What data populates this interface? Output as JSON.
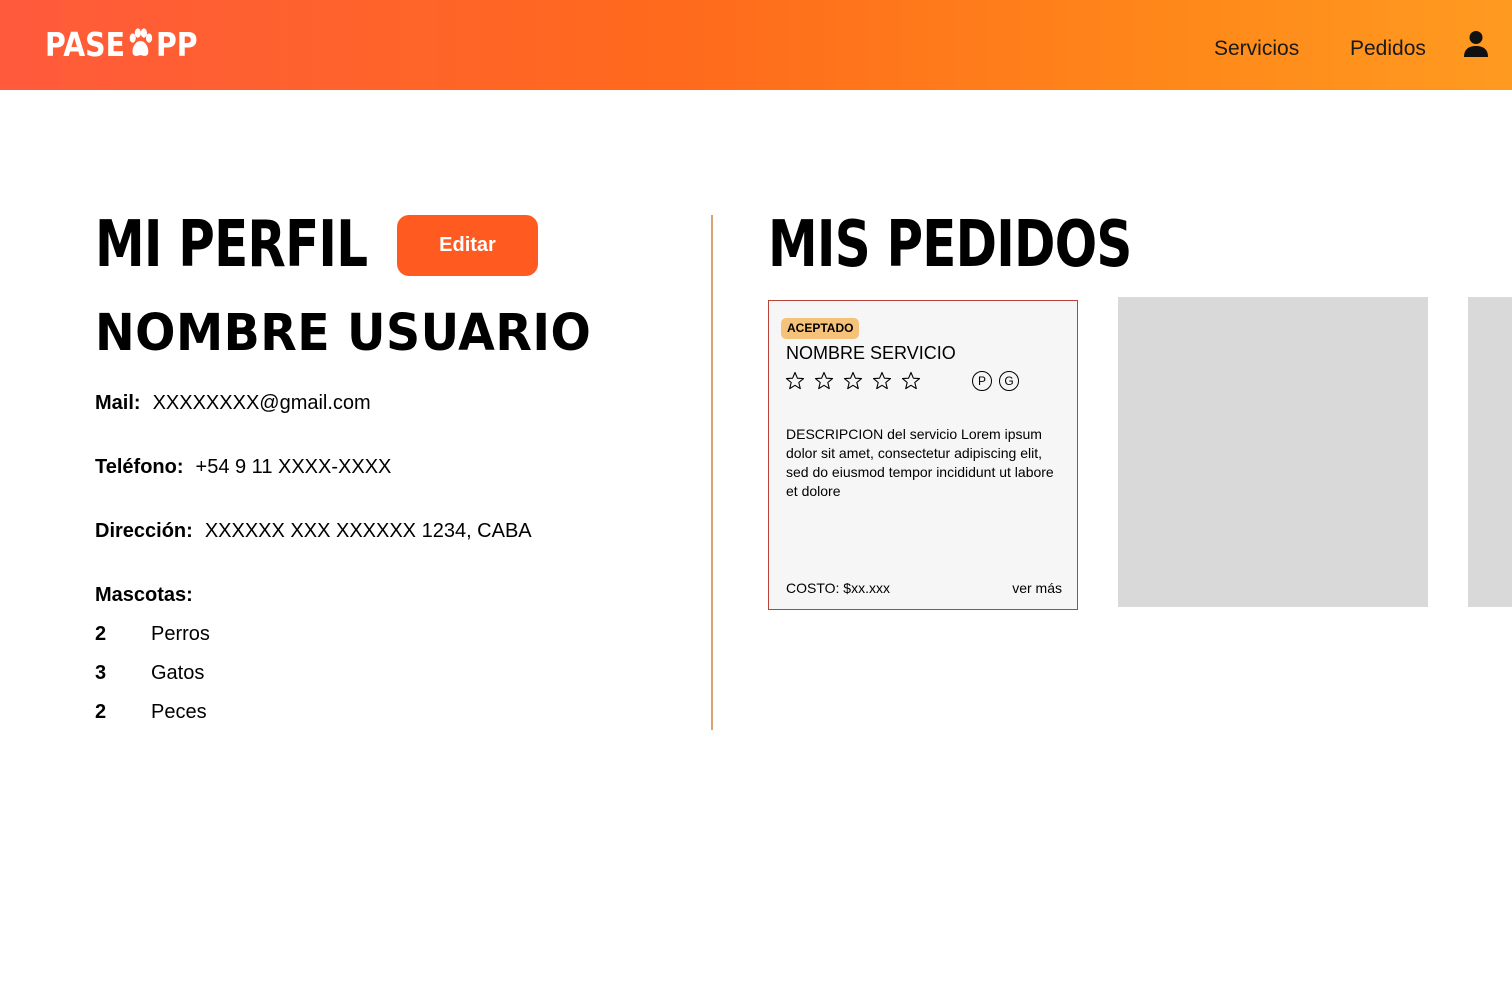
{
  "header": {
    "logo_left": "PASE",
    "logo_right": "PP",
    "nav": {
      "servicios": "Servicios",
      "pedidos": "Pedidos"
    },
    "user_icon": "user-icon"
  },
  "profile": {
    "title": "MI PERFIL",
    "edit_label": "Editar",
    "username": "NOMBRE USUARIO",
    "mail_label": "Mail:",
    "mail_value": "XXXXXXXX@gmail.com",
    "phone_label": "Teléfono:",
    "phone_value": "+54 9 11 XXXX-XXXX",
    "address_label": "Dirección:",
    "address_value": "XXXXXX XXX XXXXXX 1234, CABA",
    "pets_label": "Mascotas:",
    "pets": [
      {
        "count": "2",
        "type": "Perros"
      },
      {
        "count": "3",
        "type": "Gatos"
      },
      {
        "count": "2",
        "type": "Peces"
      }
    ]
  },
  "orders": {
    "title": "MIS PEDIDOS",
    "cards": [
      {
        "status": "ACEPTADO",
        "service_name": "NOMBRE SERVICIO",
        "rating": 0,
        "badges": [
          "P",
          "G"
        ],
        "description": "DESCRIPCION del servicio Lorem ipsum dolor sit amet, consectetur adipiscing elit, sed do eiusmod tempor incididunt ut labore et dolore",
        "cost": "COSTO: $xx.xxx",
        "more": "ver más"
      }
    ]
  },
  "colors": {
    "accent": "#ff5a1f",
    "header_start": "#ff5a3c",
    "header_end": "#ff9a20",
    "badge": "#f6c27a",
    "card_border": "#b8433a",
    "placeholder": "#d9d9d9",
    "divider": "#d9a070"
  }
}
